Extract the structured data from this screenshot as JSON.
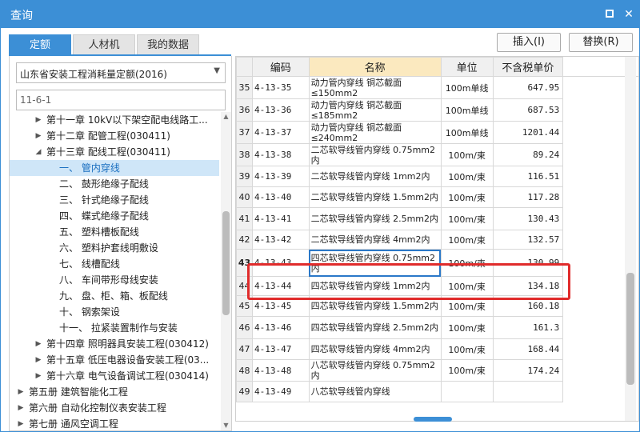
{
  "window": {
    "title": "查询"
  },
  "tabs": [
    {
      "label": "定额",
      "active": true
    },
    {
      "label": "人材机",
      "active": false
    },
    {
      "label": "我的数据",
      "active": false
    }
  ],
  "buttons": {
    "insert": "插入(I)",
    "replace": "替换(R)"
  },
  "left": {
    "library_select": "山东省安装工程消耗量定额(2016)",
    "search_value": "11-6-1",
    "tree": [
      {
        "label": "第十一章 10kV以下架空配电线路工...",
        "level": 2,
        "arrow": "right"
      },
      {
        "label": "第十二章 配管工程(030411)",
        "level": 2,
        "arrow": "right"
      },
      {
        "label": "第十三章 配线工程(030411)",
        "level": 2,
        "arrow": "down"
      },
      {
        "label": "一、 管内穿线",
        "level": 3,
        "selected": true
      },
      {
        "label": "二、 鼓形绝缘子配线",
        "level": 3
      },
      {
        "label": "三、 针式绝缘子配线",
        "level": 3
      },
      {
        "label": "四、 蝶式绝缘子配线",
        "level": 3
      },
      {
        "label": "五、 塑料槽板配线",
        "level": 3
      },
      {
        "label": "六、 塑料护套线明敷设",
        "level": 3
      },
      {
        "label": "七、 线槽配线",
        "level": 3
      },
      {
        "label": "八、 车间带形母线安装",
        "level": 3
      },
      {
        "label": "九、 盘、柜、箱、板配线",
        "level": 3
      },
      {
        "label": "十、 钢索架设",
        "level": 3
      },
      {
        "label": "十一、 拉紧装置制作与安装",
        "level": 3
      },
      {
        "label": "第十四章 照明器具安装工程(030412)",
        "level": 2,
        "arrow": "right"
      },
      {
        "label": "第十五章 低压电器设备安装工程(03...",
        "level": 2,
        "arrow": "right"
      },
      {
        "label": "第十六章 电气设备调试工程(030414)",
        "level": 2,
        "arrow": "right"
      },
      {
        "label": "第五册 建筑智能化工程",
        "level": 1,
        "arrow": "right"
      },
      {
        "label": "第六册 自动化控制仪表安装工程",
        "level": 1,
        "arrow": "right"
      },
      {
        "label": "第七册 通风空调工程",
        "level": 1,
        "arrow": "right"
      }
    ]
  },
  "grid": {
    "headers": {
      "code": "编码",
      "name": "名称",
      "unit": "单位",
      "price": "不含税单价"
    },
    "rows": [
      {
        "n": "35",
        "code": "4-13-35",
        "name": "动力管内穿线 铜芯截面≤150mm2",
        "unit": "100m单线",
        "price": "647.95"
      },
      {
        "n": "36",
        "code": "4-13-36",
        "name": "动力管内穿线 铜芯截面≤185mm2",
        "unit": "100m单线",
        "price": "687.53"
      },
      {
        "n": "37",
        "code": "4-13-37",
        "name": "动力管内穿线 铜芯截面≤240mm2",
        "unit": "100m单线",
        "price": "1201.44"
      },
      {
        "n": "38",
        "code": "4-13-38",
        "name": "二芯软导线管内穿线 0.75mm2内",
        "unit": "100m/束",
        "price": "89.24"
      },
      {
        "n": "39",
        "code": "4-13-39",
        "name": "二芯软导线管内穿线 1mm2内",
        "unit": "100m/束",
        "price": "116.51"
      },
      {
        "n": "40",
        "code": "4-13-40",
        "name": "二芯软导线管内穿线 1.5mm2内",
        "unit": "100m/束",
        "price": "117.28"
      },
      {
        "n": "41",
        "code": "4-13-41",
        "name": "二芯软导线管内穿线 2.5mm2内",
        "unit": "100m/束",
        "price": "130.43"
      },
      {
        "n": "42",
        "code": "4-13-42",
        "name": "二芯软导线管内穿线 4mm2内",
        "unit": "100m/束",
        "price": "132.57"
      },
      {
        "n": "43",
        "code": "4-13-43",
        "name": "四芯软导线管内穿线 0.75mm2内",
        "unit": "100m/束",
        "price": "130.99"
      },
      {
        "n": "44",
        "code": "4-13-44",
        "name": "四芯软导线管内穿线 1mm2内",
        "unit": "100m/束",
        "price": "134.18"
      },
      {
        "n": "45",
        "code": "4-13-45",
        "name": "四芯软导线管内穿线 1.5mm2内",
        "unit": "100m/束",
        "price": "160.18"
      },
      {
        "n": "46",
        "code": "4-13-46",
        "name": "四芯软导线管内穿线 2.5mm2内",
        "unit": "100m/束",
        "price": "161.3"
      },
      {
        "n": "47",
        "code": "4-13-47",
        "name": "四芯软导线管内穿线 4mm2内",
        "unit": "100m/束",
        "price": "168.44"
      },
      {
        "n": "48",
        "code": "4-13-48",
        "name": "八芯软导线管内穿线 0.75mm2内",
        "unit": "100m/束",
        "price": "174.24"
      },
      {
        "n": "49",
        "code": "4-13-49",
        "name": "八芯软导线管内穿线",
        "unit": "",
        "price": ""
      }
    ],
    "current_row": "43"
  },
  "colors": {
    "accent": "#3c8fd6",
    "highlight": "#e02b2b",
    "name_header": "#fbe9bf",
    "selected_tree": "#cfe6f8"
  }
}
